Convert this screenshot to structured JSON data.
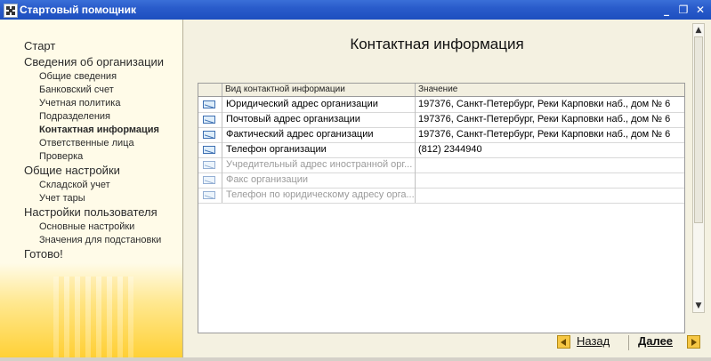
{
  "window": {
    "title": "Стартовый помощник",
    "controls": [
      "_",
      "❐",
      "✕"
    ]
  },
  "sidebar": {
    "items": [
      {
        "label": "Старт",
        "level": 1
      },
      {
        "label": "Сведения об организации",
        "level": 1
      },
      {
        "label": "Общие сведения",
        "level": 2
      },
      {
        "label": "Банковский счет",
        "level": 2
      },
      {
        "label": "Учетная политика",
        "level": 2
      },
      {
        "label": "Подразделения",
        "level": 2
      },
      {
        "label": "Контактная информация",
        "level": 2,
        "active": true
      },
      {
        "label": "Ответственные лица",
        "level": 2
      },
      {
        "label": "Проверка",
        "level": 2
      },
      {
        "label": "Общие настройки",
        "level": 1
      },
      {
        "label": "Складской учет",
        "level": 2
      },
      {
        "label": "Учет тары",
        "level": 2
      },
      {
        "label": "Настройки пользователя",
        "level": 1
      },
      {
        "label": "Основные настройки",
        "level": 2
      },
      {
        "label": "Значения для подстановки",
        "level": 2
      },
      {
        "label": "Готово!",
        "level": 1
      }
    ]
  },
  "main": {
    "heading": "Контактная информация",
    "table": {
      "columns": [
        "Вид контактной информации",
        "Значение"
      ],
      "rows": [
        {
          "kind": "Юридический адрес организации",
          "value": "197376, Санкт-Петербург, Реки Карповки наб., дом № 6",
          "filled": true
        },
        {
          "kind": "Почтовый адрес организации",
          "value": "197376, Санкт-Петербург, Реки Карповки наб., дом № 6",
          "filled": true
        },
        {
          "kind": "Фактический адрес организации",
          "value": "197376, Санкт-Петербург, Реки Карповки наб., дом № 6",
          "filled": true
        },
        {
          "kind": "Телефон организации",
          "value": "(812) 2344940",
          "filled": true
        },
        {
          "kind": "Учредительный адрес иностранной орг...",
          "value": "",
          "filled": false
        },
        {
          "kind": "Факс организации",
          "value": "",
          "filled": false
        },
        {
          "kind": "Телефон по юридическому адресу орга...",
          "value": "",
          "filled": false
        }
      ]
    }
  },
  "footer": {
    "back_label": "Назад",
    "next_label": "Далее"
  }
}
